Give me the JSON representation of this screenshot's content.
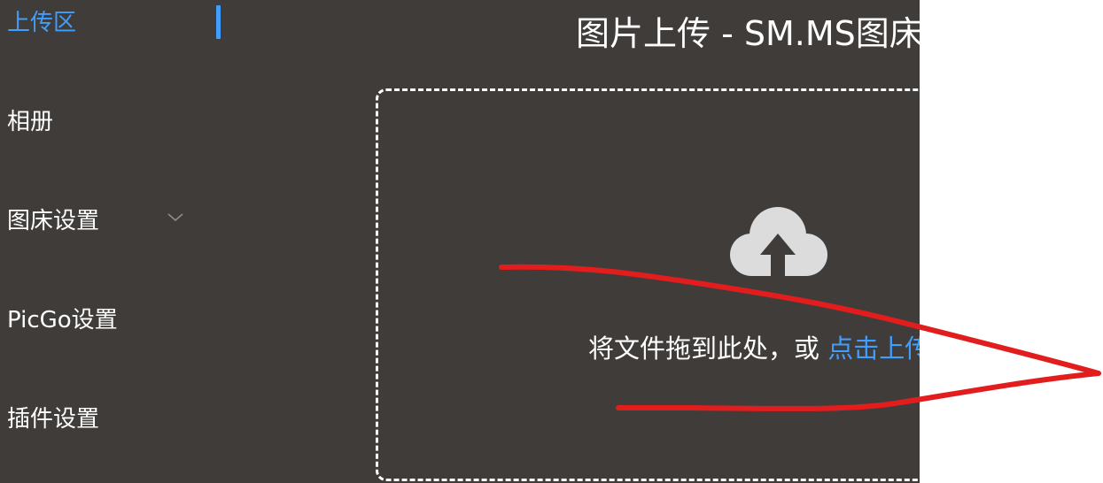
{
  "sidebar": {
    "items": [
      {
        "label": "上传区",
        "active": true
      },
      {
        "label": "相册"
      },
      {
        "label": "图床设置",
        "expandable": true
      },
      {
        "label": "PicGo设置"
      },
      {
        "label": "插件设置"
      }
    ]
  },
  "main": {
    "title": "图片上传 - SM.MS图床",
    "dropzone": {
      "icon": "cloud-upload-icon",
      "text": "将文件拖到此处，或 ",
      "link": "点击上传"
    }
  },
  "colors": {
    "background": "#403c39",
    "accent": "#409eff",
    "annotation": "#e11d1d"
  }
}
